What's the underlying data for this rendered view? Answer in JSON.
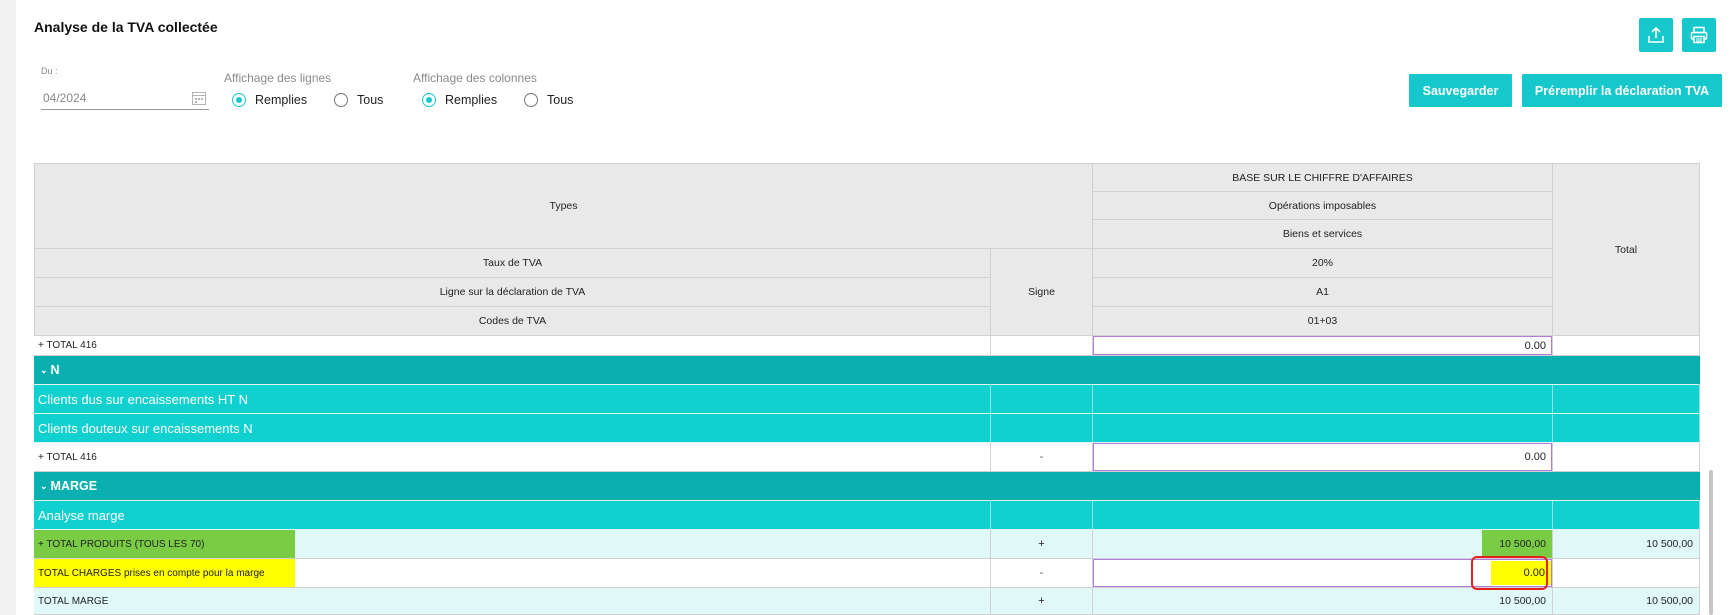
{
  "page": {
    "title": "Analyse de la TVA collectée"
  },
  "toolbar": {
    "export_icon": "upload-icon",
    "print_icon": "printer-icon",
    "save_label": "Sauvegarder",
    "prefill_label": "Préremplir la déclaration TVA"
  },
  "filters": {
    "date_label": "Du :",
    "date_value": "04/2024",
    "lines_label": "Affichage des lignes",
    "lines_options": [
      "Remplies",
      "Tous"
    ],
    "lines_selected": "Remplies",
    "columns_label": "Affichage des colonnes",
    "columns_options": [
      "Remplies",
      "Tous"
    ],
    "columns_selected": "Remplies"
  },
  "table": {
    "header": {
      "types": "Types",
      "base": "BASE SUR LE CHIFFRE D'AFFAIRES",
      "operations": "Opérations imposables",
      "biens": "Biens et services",
      "taux_label": "Taux de TVA",
      "taux_value": "20%",
      "ligne_label": "Ligne sur la déclaration de TVA",
      "ligne_value": "A1",
      "codes_label": "Codes de TVA",
      "codes_value": "01+03",
      "signe": "Signe",
      "total": "Total"
    },
    "rows": [
      {
        "type": "data",
        "label": "+ TOTAL 416",
        "signe": "",
        "value": "0.00",
        "total": ""
      },
      {
        "type": "section",
        "label": "N"
      },
      {
        "type": "subsection",
        "label": "Clients dus sur encaissements HT N"
      },
      {
        "type": "subsection",
        "label": "Clients douteux sur encaissements N"
      },
      {
        "type": "data",
        "label": "+ TOTAL 416",
        "signe": "-",
        "value": "0.00",
        "total": ""
      },
      {
        "type": "section",
        "label": "MARGE"
      },
      {
        "type": "subsection",
        "label": "Analyse marge"
      },
      {
        "type": "data",
        "label": "+ TOTAL PRODUITS (TOUS LES 70)",
        "signe": "+",
        "value": "10 500,00",
        "total": "10 500,00"
      },
      {
        "type": "data",
        "label": "TOTAL CHARGES prises en compte pour la marge",
        "signe": "-",
        "value": "0.00",
        "total": ""
      },
      {
        "type": "data",
        "label": "TOTAL MARGE",
        "signe": "+",
        "value": "10 500,00",
        "total": "10 500,00"
      }
    ]
  },
  "colors": {
    "accent": "#16c8cc",
    "section_teal": "#0ab0b0",
    "subsection_teal": "#10d0d0",
    "green_highlight": "#7acc44",
    "yellow_highlight": "#ffff00",
    "focus_ring": "#e32222"
  }
}
